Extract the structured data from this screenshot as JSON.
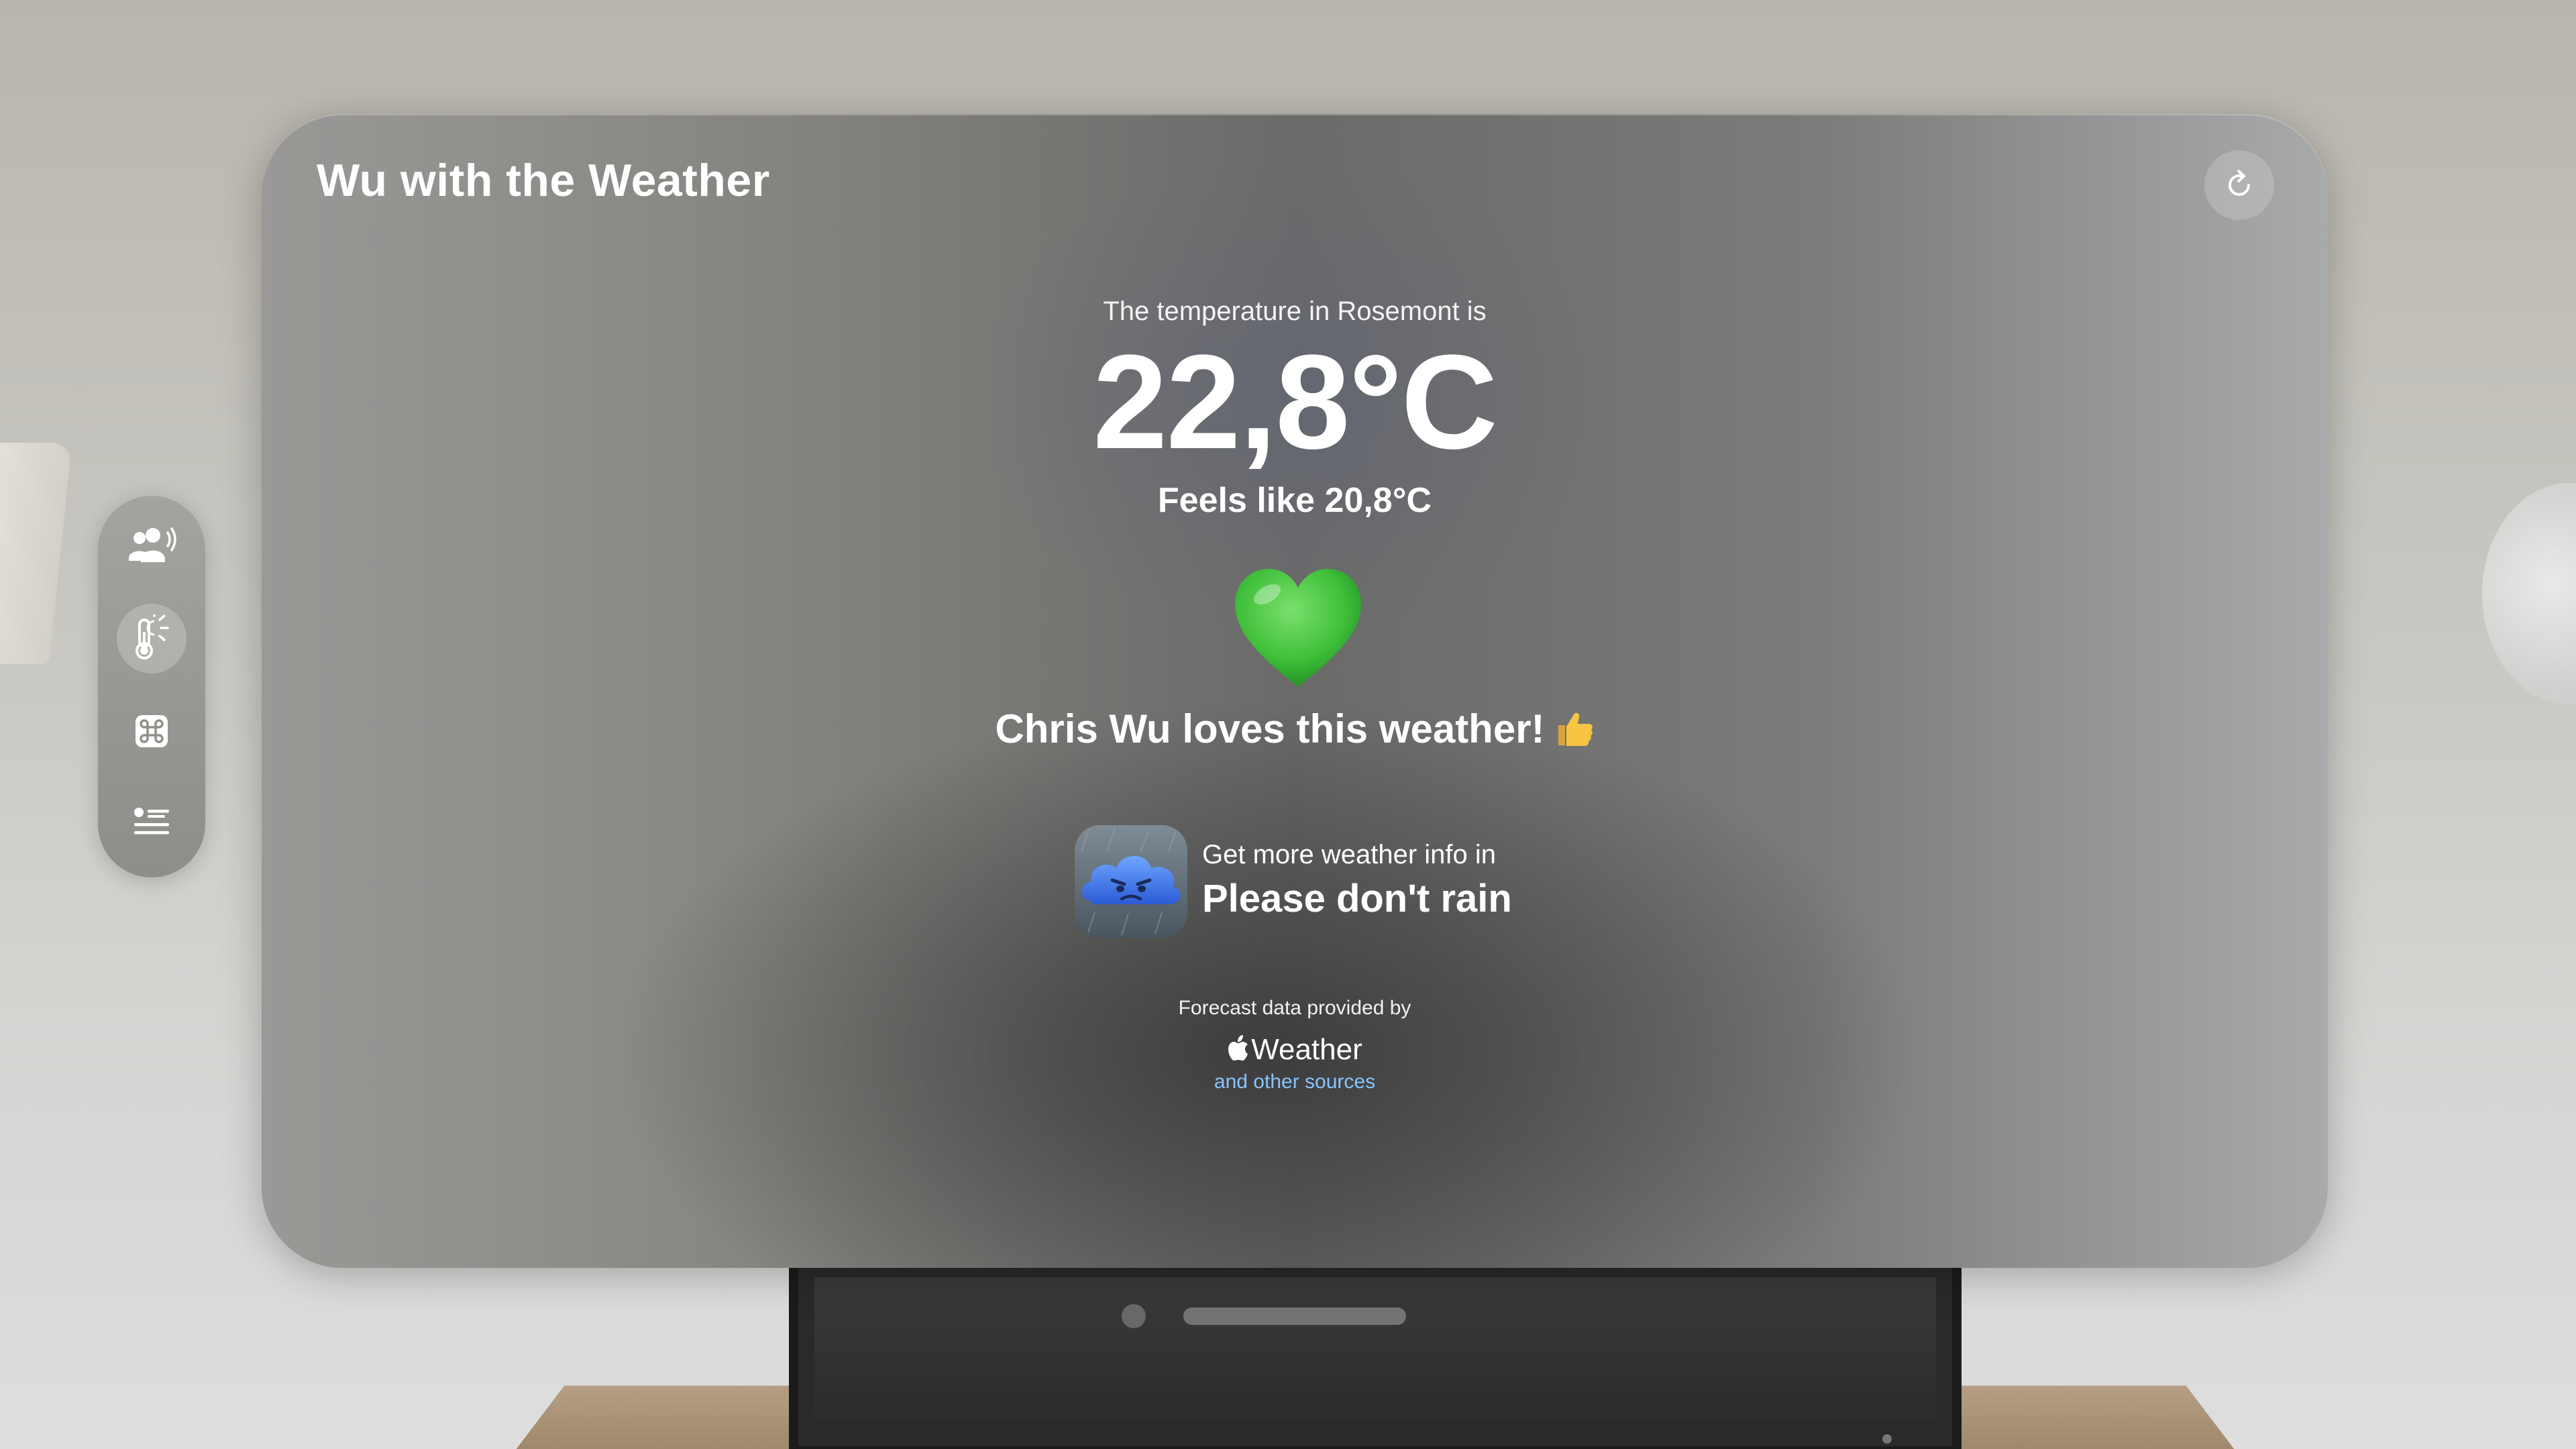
{
  "app": {
    "title": "Wu with the Weather"
  },
  "weather": {
    "intro": "The temperature in Rosemont is",
    "temperature": "22,8°C",
    "feels_like": "Feels like 20,8°C",
    "verdict": "Chris Wu loves this weather!"
  },
  "promo": {
    "subtitle": "Get more weather info in",
    "app_name": "Please don't rain"
  },
  "attribution": {
    "label": "Forecast data provided by",
    "brand": "Weather",
    "link": "and other sources"
  },
  "tabs": [
    {
      "name": "people-audio-icon",
      "active": false
    },
    {
      "name": "thermometer-sun-icon",
      "active": true
    },
    {
      "name": "command-icon",
      "active": false
    },
    {
      "name": "list-icon",
      "active": false
    }
  ],
  "colors": {
    "link": "#86c5ff",
    "heart": "#3fbf3a",
    "text": "#ffffff"
  }
}
